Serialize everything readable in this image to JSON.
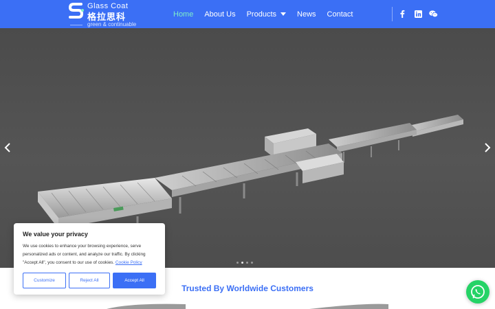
{
  "brand": {
    "name_en_first": "G",
    "name_en_rest": "lass Coat",
    "name_cn": "格拉思科",
    "tagline": "green & continuable"
  },
  "nav": {
    "items": [
      {
        "label": "Home",
        "active": true
      },
      {
        "label": "About Us",
        "active": false
      },
      {
        "label": "Products",
        "active": false,
        "dropdown": true
      },
      {
        "label": "News",
        "active": false
      },
      {
        "label": "Contact",
        "active": false
      }
    ]
  },
  "social": [
    "facebook-icon",
    "linkedin-icon",
    "wechat-icon"
  ],
  "hero": {
    "slides": 4,
    "active_slide": 2
  },
  "trusted": {
    "heading": "Trusted By Worldwide Customers"
  },
  "cookie": {
    "title": "We value your privacy",
    "text": "We use cookies to enhance your browsing experience, serve personalized ads or content, and analyze our traffic. By clicking \"Accept All\", you consent to our use of cookies.",
    "link": "Cookie Policy",
    "customize": "Customize",
    "reject": "Reject All",
    "accept": "Accept All"
  },
  "colors": {
    "header": "#3b6ff5",
    "nav_active": "#7ff0c8",
    "whatsapp": "#25d366"
  }
}
